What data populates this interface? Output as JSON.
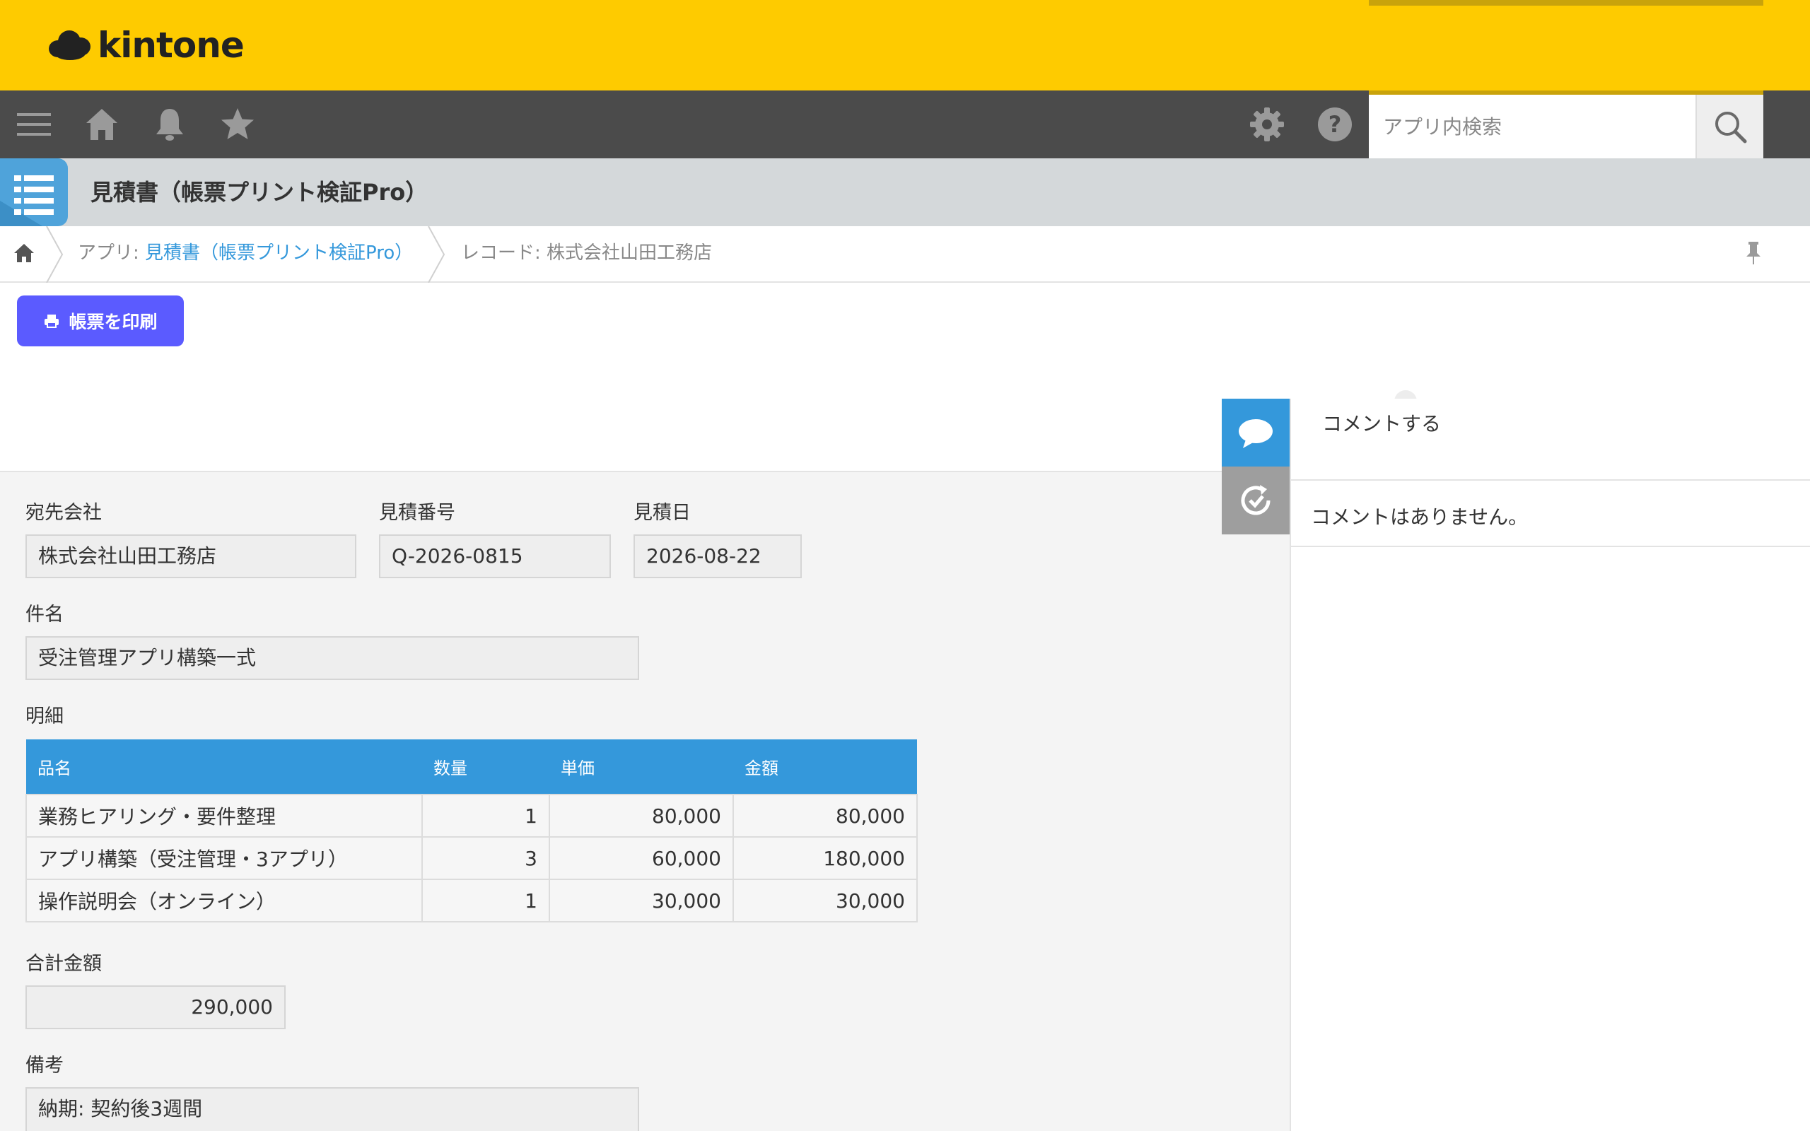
{
  "header": {
    "logo_text": "kintone",
    "brand_color": "#FECB00"
  },
  "toolbar": {
    "menu_icon": "hamburger-menu-icon",
    "home_icon": "home-icon",
    "notification_icon": "bell-icon",
    "favorite_icon": "star-icon",
    "settings_icon": "gear-icon",
    "help_icon": "help-icon",
    "search": {
      "placeholder": "アプリ内検索",
      "value": "",
      "button_icon": "search-icon"
    }
  },
  "app": {
    "icon": "table-list-icon",
    "title": "見積書（帳票プリント検証Pro）"
  },
  "breadcrumb": {
    "app_prefix": "アプリ: ",
    "app_name": "見積書（帳票プリント検証Pro）",
    "record_prefix": "レコード: ",
    "record_name": "株式会社山田工務店"
  },
  "actions": {
    "print_label": "帳票を印刷",
    "print_icon": "printer-icon"
  },
  "record": {
    "fields": {
      "company": {
        "label": "宛先会社",
        "value": "株式会社山田工務店"
      },
      "quote_no": {
        "label": "見積番号",
        "value": "Q-2026-0815"
      },
      "quote_date": {
        "label": "見積日",
        "value": "2026-08-22"
      },
      "subject": {
        "label": "件名",
        "value": "受注管理アプリ構築一式"
      },
      "total": {
        "label": "合計金額",
        "value": "290,000"
      },
      "remarks": {
        "label": "備考",
        "value": "納期: 契約後3週間"
      }
    },
    "details": {
      "label": "明細",
      "columns": [
        "品名",
        "数量",
        "単価",
        "金額"
      ],
      "rows": [
        [
          "業務ヒアリング・要件整理",
          "1",
          "80,000",
          "80,000"
        ],
        [
          "アプリ構築（受注管理・3アプリ）",
          "3",
          "60,000",
          "180,000"
        ],
        [
          "操作説明会（オンライン）",
          "1",
          "30,000",
          "30,000"
        ]
      ],
      "header_color": "#3498DB"
    }
  },
  "side_panel": {
    "comment_tab_icon": "speech-bubble-icon",
    "history_tab_icon": "history-icon",
    "compose_label": "コメントする",
    "empty_message": "コメントはありません。",
    "active_tab_color": "#3498DB"
  }
}
